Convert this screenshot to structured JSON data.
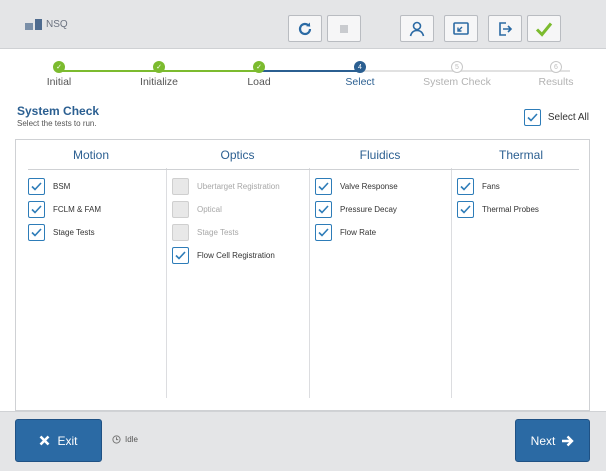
{
  "app": {
    "brand": "NSQ"
  },
  "toolbar": {
    "refresh_icon": "refresh-icon",
    "stop_icon": "stop-icon",
    "user_icon": "user-icon",
    "minimize_icon": "minimize-icon",
    "logout_icon": "logout-icon",
    "confirm_icon": "check-icon"
  },
  "stepper": {
    "steps": [
      {
        "label": "Initial",
        "state": "done"
      },
      {
        "label": "Initialize",
        "state": "done"
      },
      {
        "label": "Load",
        "state": "done"
      },
      {
        "label": "Select",
        "state": "current",
        "number": "4"
      },
      {
        "label": "System Check",
        "state": "future",
        "number": "5"
      },
      {
        "label": "Results",
        "state": "future",
        "number": "6"
      }
    ]
  },
  "header": {
    "title": "System Check",
    "subtitle": "Select the tests to run.",
    "select_all_label": "Select All",
    "select_all_checked": true
  },
  "categories": [
    {
      "title": "Motion",
      "items": [
        {
          "label": "BSM",
          "checked": true,
          "disabled": false
        },
        {
          "label": "FCLM & FAM",
          "checked": true,
          "disabled": false
        },
        {
          "label": "Stage Tests",
          "checked": true,
          "disabled": false
        }
      ]
    },
    {
      "title": "Optics",
      "items": [
        {
          "label": "Ubertarget Registration",
          "checked": false,
          "disabled": true
        },
        {
          "label": "Optical",
          "checked": false,
          "disabled": true
        },
        {
          "label": "Stage Tests",
          "checked": false,
          "disabled": true
        },
        {
          "label": "Flow Cell Registration",
          "checked": true,
          "disabled": false
        }
      ]
    },
    {
      "title": "Fluidics",
      "items": [
        {
          "label": "Valve Response",
          "checked": true,
          "disabled": false
        },
        {
          "label": "Pressure Decay",
          "checked": true,
          "disabled": false
        },
        {
          "label": "Flow Rate",
          "checked": true,
          "disabled": false
        }
      ]
    },
    {
      "title": "Thermal",
      "items": [
        {
          "label": "Fans",
          "checked": true,
          "disabled": false
        },
        {
          "label": "Thermal Probes",
          "checked": true,
          "disabled": false
        }
      ]
    }
  ],
  "footer": {
    "exit_label": "Exit",
    "next_label": "Next",
    "status_text": "Idle"
  },
  "colors": {
    "accent": "#2b6aa4",
    "done": "#7cbb2f",
    "title": "#2b5f91"
  }
}
